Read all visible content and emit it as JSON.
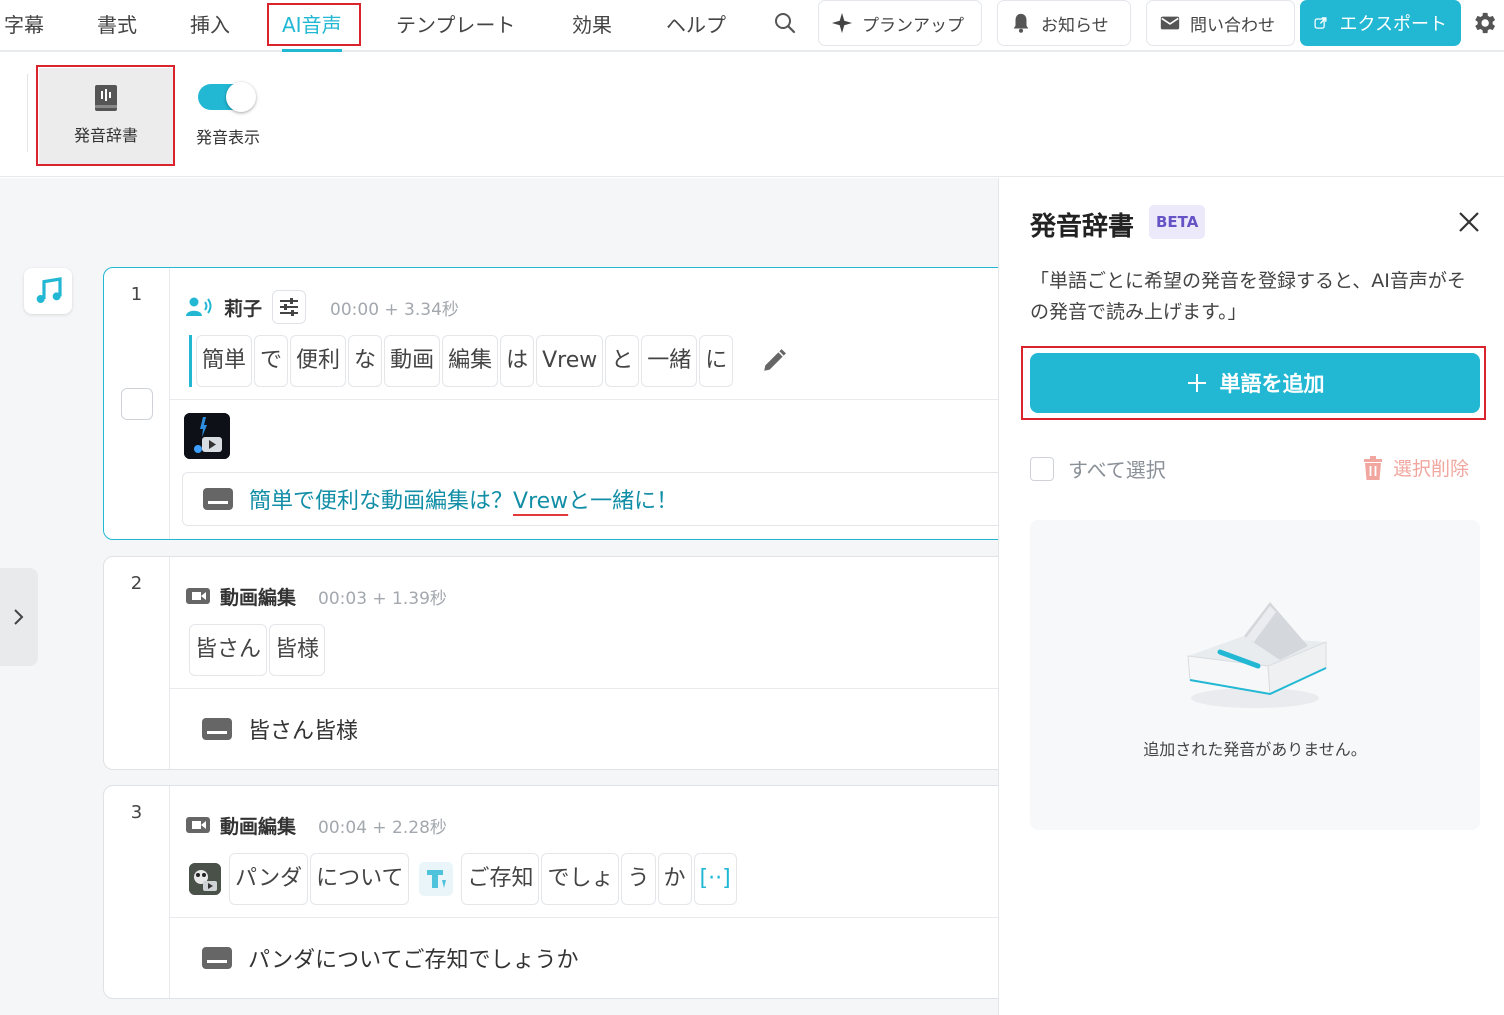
{
  "menu": {
    "items": [
      {
        "label": "字幕"
      },
      {
        "label": "書式"
      },
      {
        "label": "挿入"
      },
      {
        "label": "AI音声",
        "active": true
      },
      {
        "label": "テンプレート"
      },
      {
        "label": "効果"
      },
      {
        "label": "ヘルプ"
      }
    ],
    "plan_up_label": "プランアップ",
    "notice_label": "お知らせ",
    "contact_label": "問い合わせ",
    "export_label": "エクスポート"
  },
  "toolbar": {
    "dictionary_label": "発音辞書",
    "display_toggle_label": "発音表示",
    "display_toggle_on": true
  },
  "clips": [
    {
      "number": "1",
      "speaker": "莉子",
      "timing": "00:00 + 3.34秒",
      "words": [
        "簡単",
        "で",
        "便利",
        "な",
        "動画",
        "編集",
        "は",
        "Vrew",
        "と",
        "一緒",
        "に"
      ],
      "subtitle_before": "簡単で便利な動画編集は？",
      "subtitle_underlined": "Vrew",
      "subtitle_after": "と一緒に！"
    },
    {
      "number": "2",
      "speaker": "動画編集",
      "timing": "00:03 + 1.39秒",
      "words": [
        "皆さん",
        "皆様"
      ],
      "subtitle": "皆さん皆様"
    },
    {
      "number": "3",
      "speaker": "動画編集",
      "timing": "00:04 + 2.28秒",
      "words": [
        "パンダ",
        "について",
        "ご存知",
        "でしょ",
        "う",
        "か",
        "[··]"
      ],
      "subtitle": "パンダについてご存知でしょうか"
    }
  ],
  "panel": {
    "title": "発音辞書",
    "badge": "BETA",
    "description": "「単語ごとに希望の発音を登録すると、AI音声がその発音で読み上げます。」",
    "add_button_label": "単語を追加",
    "select_all_label": "すべて選択",
    "delete_selected_label": "選択削除",
    "empty_message": "追加された発音がありません。"
  },
  "colors": {
    "accent": "#22b8d4",
    "highlight": "#d9232d",
    "beta_bg": "#ece9fb",
    "beta_text": "#6654c6",
    "delete_text": "#f1a79f"
  }
}
